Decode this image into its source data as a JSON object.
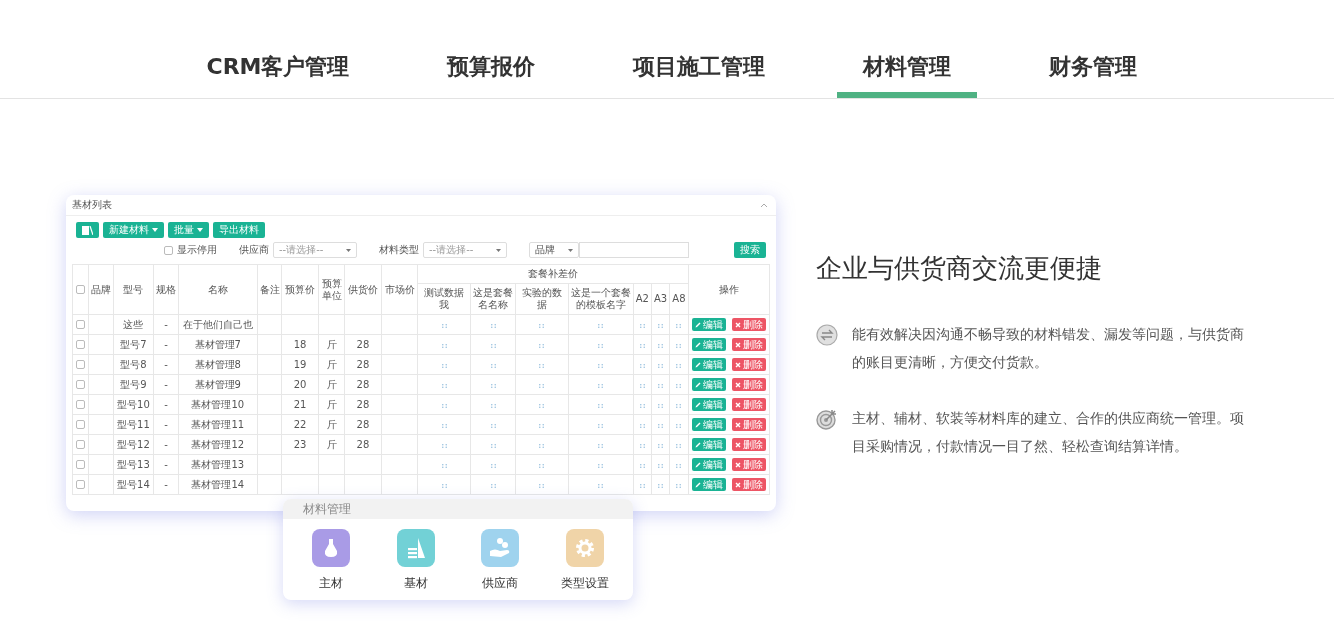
{
  "tabs": [
    {
      "label": "CRM客户管理",
      "selected": false
    },
    {
      "label": "预算报价",
      "selected": false
    },
    {
      "label": "项目施工管理",
      "selected": false
    },
    {
      "label": "材料管理",
      "selected": true
    },
    {
      "label": "财务管理",
      "selected": false
    }
  ],
  "showcase": {
    "title": "基材列表",
    "toolbar": [
      {
        "kind": "icon"
      },
      {
        "kind": "dropdown",
        "label": "新建材料"
      },
      {
        "kind": "dropdown",
        "label": "批量"
      },
      {
        "kind": "plain",
        "label": "导出材料"
      }
    ],
    "show_disabled": {
      "label": "显示停用",
      "checked": false
    },
    "supplier": {
      "label": "供应商",
      "placeholder": "--请选择--"
    },
    "material_type": {
      "label": "材料类型",
      "placeholder": "--请选择--"
    },
    "brand_select": "品牌",
    "search_button": "搜索",
    "table": {
      "select_all": {
        "checked": false
      },
      "columns": [
        "品牌",
        "型号",
        "规格",
        "名称",
        "备注",
        "预算价",
        "预算单位",
        "供货价",
        "市场价"
      ],
      "group_header": "套餐补差价",
      "group_columns": [
        "测试数据我",
        "这是套餐名名称",
        "实验的数据",
        "这是一个套餐的模板名字",
        "A2",
        "A3",
        "A8"
      ],
      "action_header": "操作",
      "rows": [
        {
          "checked": false,
          "cells": [
            null,
            "这些",
            "-",
            "在于他们自己也",
            null,
            null,
            null,
            null,
            null
          ],
          "edit": "编辑",
          "delete": "删除"
        },
        {
          "checked": false,
          "cells": [
            null,
            "型号7",
            "-",
            "基材管理7",
            null,
            "18",
            "斤",
            "28",
            null
          ],
          "edit": "编辑",
          "delete": "删除"
        },
        {
          "checked": false,
          "cells": [
            null,
            "型号8",
            "-",
            "基材管理8",
            null,
            "19",
            "斤",
            "28",
            null
          ],
          "edit": "编辑",
          "delete": "删除"
        },
        {
          "checked": false,
          "cells": [
            null,
            "型号9",
            "-",
            "基材管理9",
            null,
            "20",
            "斤",
            "28",
            null
          ],
          "edit": "编辑",
          "delete": "删除"
        },
        {
          "checked": false,
          "cells": [
            null,
            "型号10",
            "-",
            "基材管理10",
            null,
            "21",
            "斤",
            "28",
            null
          ],
          "edit": "编辑",
          "delete": "删除"
        },
        {
          "checked": false,
          "cells": [
            null,
            "型号11",
            "-",
            "基材管理11",
            null,
            "22",
            "斤",
            "28",
            null
          ],
          "edit": "编辑",
          "delete": "删除"
        },
        {
          "checked": false,
          "cells": [
            null,
            "型号12",
            "-",
            "基材管理12",
            null,
            "23",
            "斤",
            "28",
            null
          ],
          "edit": "编辑",
          "delete": "删除"
        },
        {
          "checked": false,
          "cells": [
            null,
            "型号13",
            "-",
            "基材管理13",
            null,
            null,
            null,
            null,
            null
          ],
          "edit": "编辑",
          "delete": "删除"
        },
        {
          "checked": false,
          "cells": [
            null,
            "型号14",
            "-",
            "基材管理14",
            null,
            null,
            null,
            null,
            null
          ],
          "edit": "编辑",
          "delete": "删除"
        }
      ]
    }
  },
  "shortcut_card": {
    "title": "材料管理",
    "items": [
      {
        "label": "主材",
        "kind": "main",
        "color": "#a99be6"
      },
      {
        "label": "基材",
        "kind": "base",
        "color": "#72d1d6"
      },
      {
        "label": "供应商",
        "kind": "supplier",
        "color": "#9fd3ee"
      },
      {
        "label": "类型设置",
        "kind": "settings",
        "color": "#f0d4a8"
      }
    ]
  },
  "feature": {
    "heading": "企业与供货商交流更便捷",
    "points": [
      {
        "kind": "exchange",
        "text": "能有效解决因沟通不畅导致的材料错发、漏发等问题，与供货商的账目更清晰，方便交付货款。"
      },
      {
        "kind": "target",
        "text": "主材、辅材、软装等材料库的建立、合作的供应商统一管理。项目采购情况，付款情况一目了然、轻松查询结算详情。"
      }
    ]
  }
}
